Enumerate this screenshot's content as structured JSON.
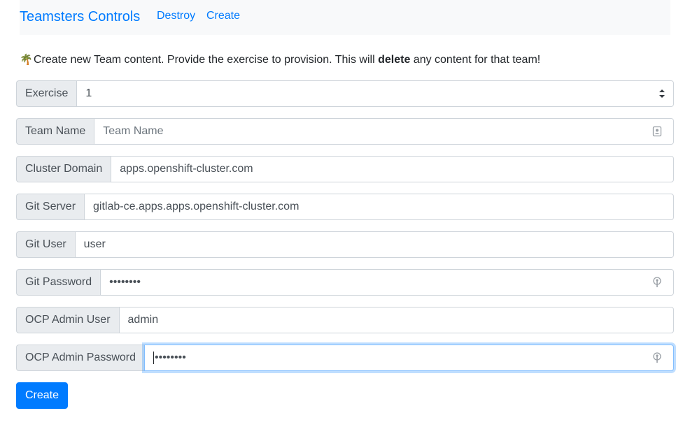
{
  "navbar": {
    "brand": "Teamsters Controls",
    "links": [
      {
        "label": "Destroy"
      },
      {
        "label": "Create"
      }
    ]
  },
  "intro": {
    "emoji": "🌴",
    "text_before": "Create new Team content. Provide the exercise to provision. This will ",
    "bold": "delete",
    "text_after": " any content for that team!"
  },
  "form": {
    "exercise": {
      "label": "Exercise",
      "value": "1"
    },
    "team_name": {
      "label": "Team Name",
      "placeholder": "Team Name",
      "value": ""
    },
    "cluster_domain": {
      "label": "Cluster Domain",
      "value": "apps.openshift-cluster.com"
    },
    "git_server": {
      "label": "Git Server",
      "value": "gitlab-ce.apps.apps.openshift-cluster.com"
    },
    "git_user": {
      "label": "Git User",
      "value": "user"
    },
    "git_password": {
      "label": "Git Password",
      "value": "••••••••"
    },
    "ocp_admin_user": {
      "label": "OCP Admin User",
      "value": "admin"
    },
    "ocp_admin_password": {
      "label": "OCP Admin Password",
      "value": "••••••••"
    }
  },
  "submit": {
    "label": "Create",
    "color": "#007bff"
  },
  "colors": {
    "link": "#007bff",
    "navbar_bg": "#f8f9fa",
    "addon_bg": "#e9ecef",
    "border": "#ced4da",
    "focus_border": "#80bdff"
  },
  "icons": {
    "select": "select-arrows-icon",
    "team_name": "contact-card-icon",
    "password": "password-key-icon"
  }
}
